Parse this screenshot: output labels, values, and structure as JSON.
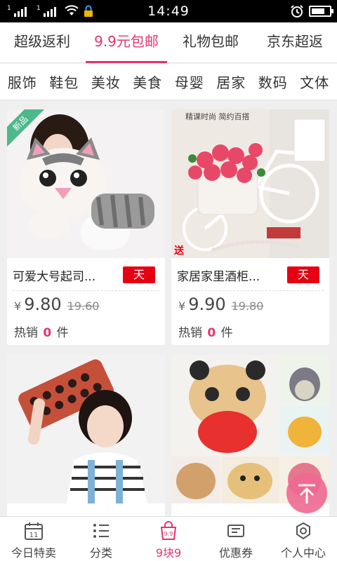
{
  "status_bar": {
    "time": "14:49",
    "signal_labels": [
      "1",
      "1"
    ],
    "battery_level": 0.75,
    "icons": [
      "signal-icon",
      "signal-icon",
      "wifi-icon",
      "lock-icon",
      "alarm-icon",
      "battery-icon"
    ]
  },
  "tabs": [
    {
      "label": "超级返利",
      "active": false
    },
    {
      "label": "9.9元包邮",
      "active": true
    },
    {
      "label": "礼物包邮",
      "active": false
    },
    {
      "label": "京东超返",
      "active": false
    }
  ],
  "subcategories": [
    "服饰",
    "鞋包",
    "美妆",
    "美食",
    "母婴",
    "居家",
    "数码",
    "文体"
  ],
  "products": [
    {
      "title": "可爱大号起司...",
      "badge": "天",
      "currency": "¥",
      "price": "9.80",
      "original_price": "19.60",
      "sales_prefix": "热销",
      "sales_count": "0",
      "sales_suffix": "件",
      "ribbon": "新品",
      "image": "plush-cat-photo"
    },
    {
      "title": "家居家里酒柜...",
      "badge": "天",
      "currency": "¥",
      "price": "9.90",
      "original_price": "19.80",
      "sales_prefix": "热销",
      "sales_count": "0",
      "sales_suffix": "件",
      "ribbon": "",
      "image": "flower-bicycle-photo",
      "image_texts": {
        "top": "精课时尚  简约百搭",
        "gift": "送"
      }
    },
    {
      "title": "",
      "image": "girl-pillow-photo"
    },
    {
      "title": "",
      "image": "plush-toys-photo"
    }
  ],
  "bottom_nav": [
    {
      "label": "今日特卖",
      "icon": "calendar-icon",
      "icon_text": "11",
      "active": false
    },
    {
      "label": "分类",
      "icon": "list-icon",
      "active": false
    },
    {
      "label": "9块9",
      "icon": "shopping-bag-icon",
      "icon_text": "9.9",
      "active": true
    },
    {
      "label": "优惠券",
      "icon": "coupon-icon",
      "active": false
    },
    {
      "label": "个人中心",
      "icon": "user-settings-icon",
      "active": false
    }
  ],
  "colors": {
    "accent": "#e5336f",
    "tmall_red": "#e60012",
    "new_ribbon": "#4db88a"
  }
}
